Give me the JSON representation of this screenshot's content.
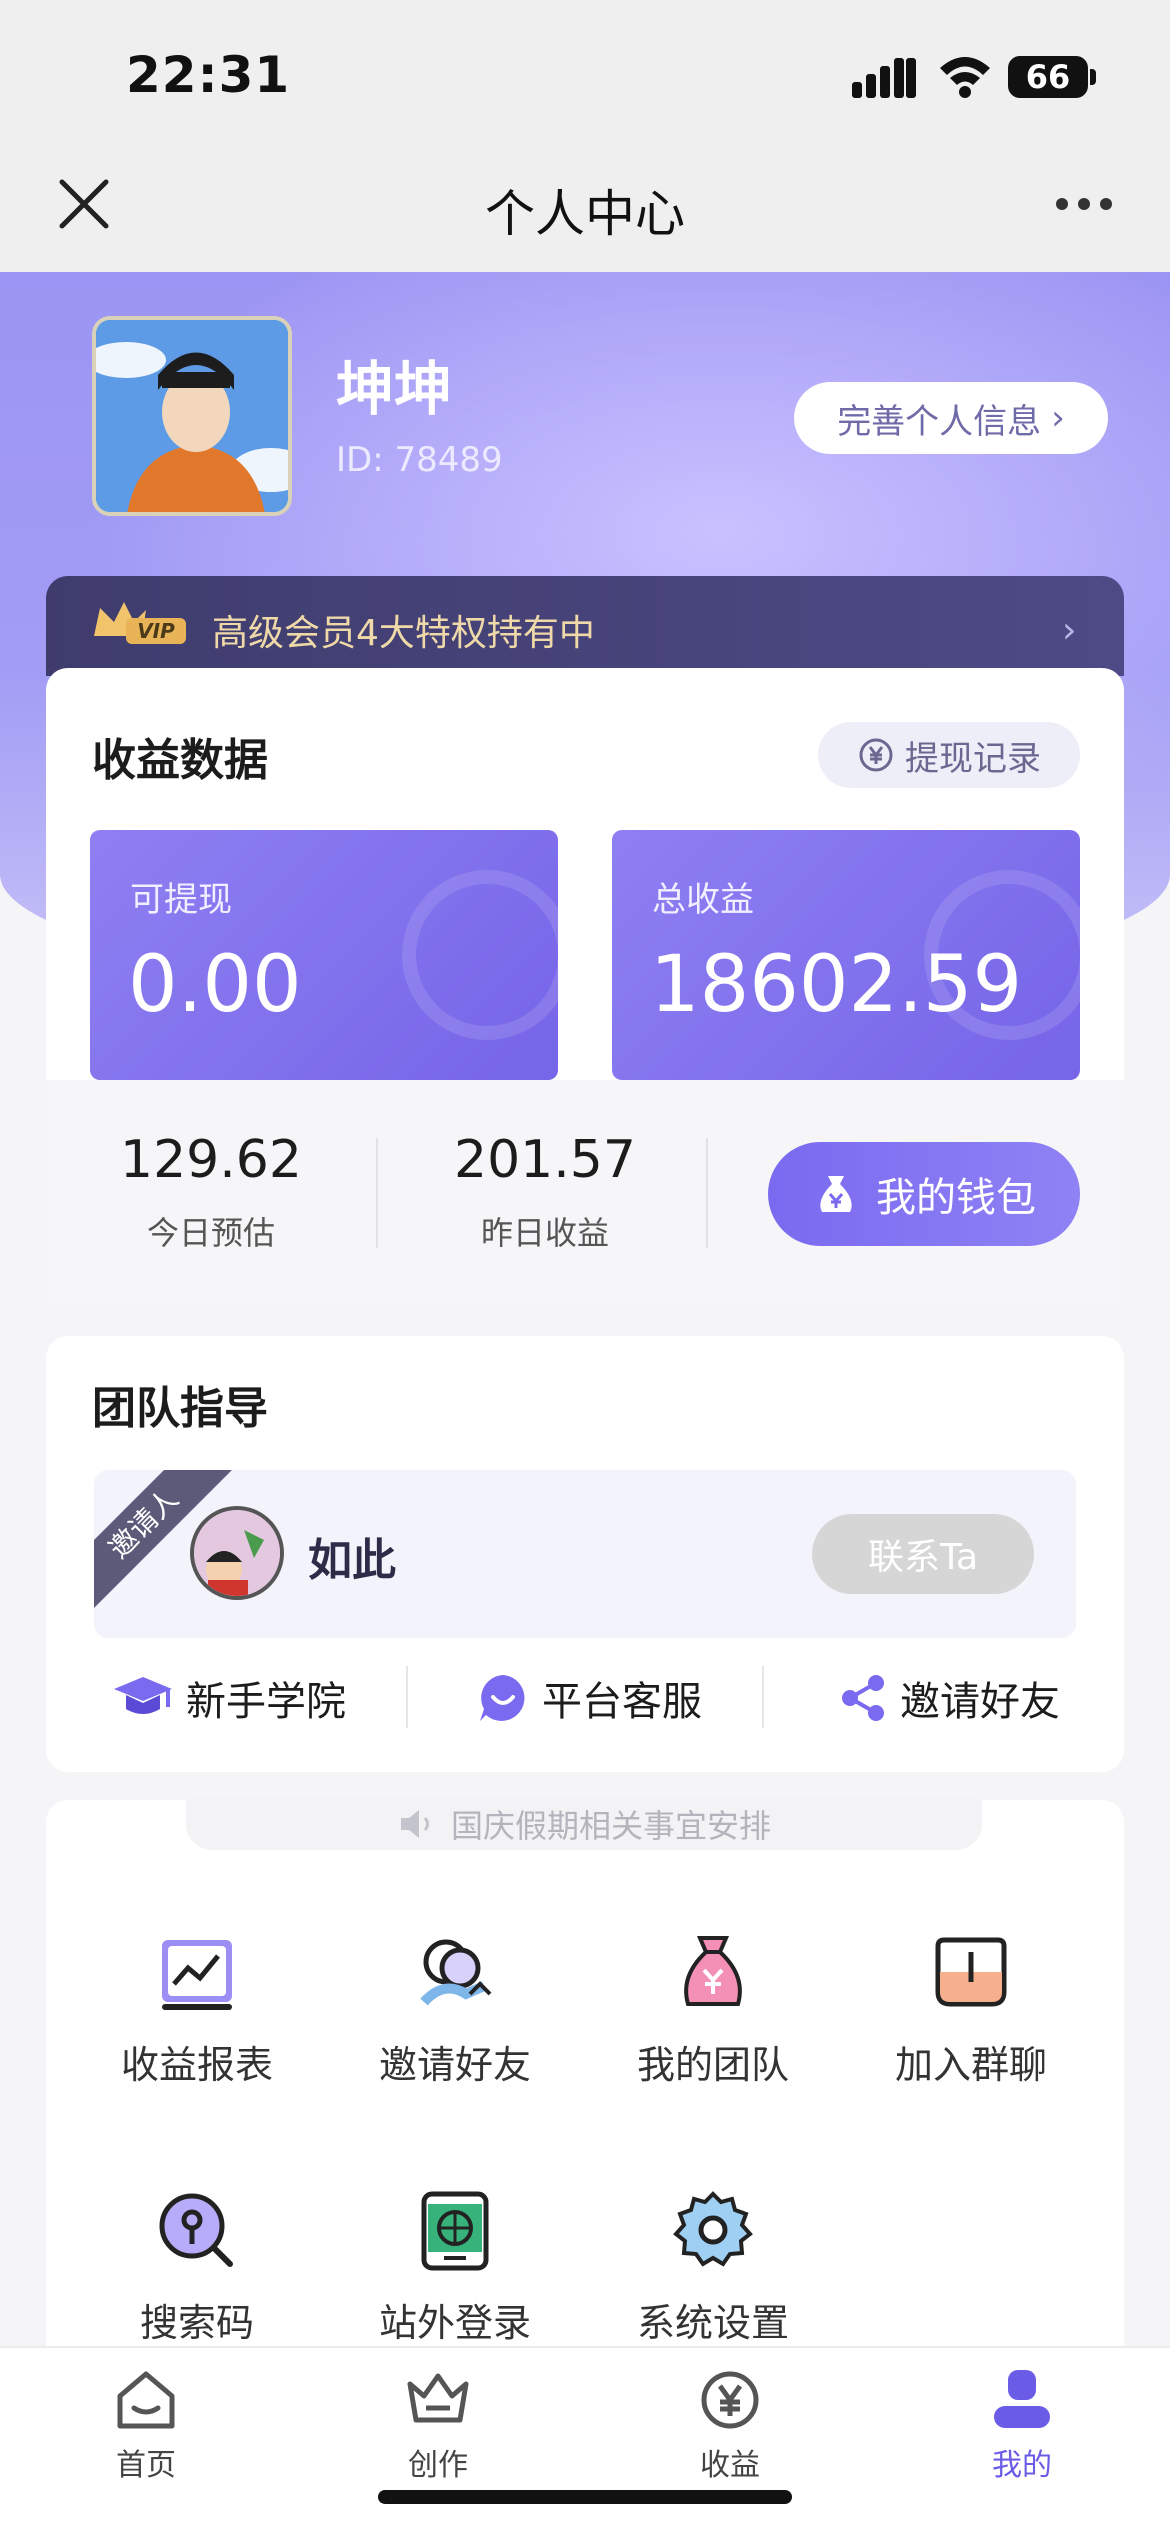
{
  "status_bar": {
    "time": "22:31",
    "battery": "66"
  },
  "nav": {
    "title": "个人中心"
  },
  "profile": {
    "name": "坤坤",
    "id": "ID: 78489",
    "edit_button": "完善个人信息"
  },
  "vip": {
    "text": "高级会员4大特权持有中",
    "badge": "VIP"
  },
  "earnings": {
    "title": "收益数据",
    "withdraw_record": "提现记录",
    "available_label": "可提现",
    "available_value": "0.00",
    "total_label": "总收益",
    "total_value": "18602.59",
    "today_value": "129.62",
    "today_label": "今日预估",
    "yesterday_value": "201.57",
    "yesterday_label": "昨日收益",
    "wallet_button": "我的钱包"
  },
  "team": {
    "title": "团队指导",
    "inviter_tag": "邀请人",
    "inviter_name": "如此",
    "contact_button": "联系Ta",
    "links": [
      "新手学院",
      "平台客服",
      "邀请好友"
    ]
  },
  "notice": "国庆假期相关事宜安排",
  "grid": [
    {
      "label": "收益报表",
      "icon": "chart-icon"
    },
    {
      "label": "邀请好友",
      "icon": "invite-friends-icon"
    },
    {
      "label": "我的团队",
      "icon": "team-moneybag-icon"
    },
    {
      "label": "加入群聊",
      "icon": "group-chat-icon"
    },
    {
      "label": "搜索码",
      "icon": "search-key-icon"
    },
    {
      "label": "站外登录",
      "icon": "external-login-icon"
    },
    {
      "label": "系统设置",
      "icon": "settings-gear-icon"
    }
  ],
  "tabs": [
    {
      "label": "首页",
      "icon": "home-icon"
    },
    {
      "label": "创作",
      "icon": "create-crown-icon"
    },
    {
      "label": "收益",
      "icon": "earnings-yen-icon"
    },
    {
      "label": "我的",
      "icon": "profile-icon",
      "active": true
    }
  ],
  "colors": {
    "accent": "#7a6af0",
    "active_tab": "#6b5ce7",
    "vip_gold": "#f0d9a8"
  }
}
